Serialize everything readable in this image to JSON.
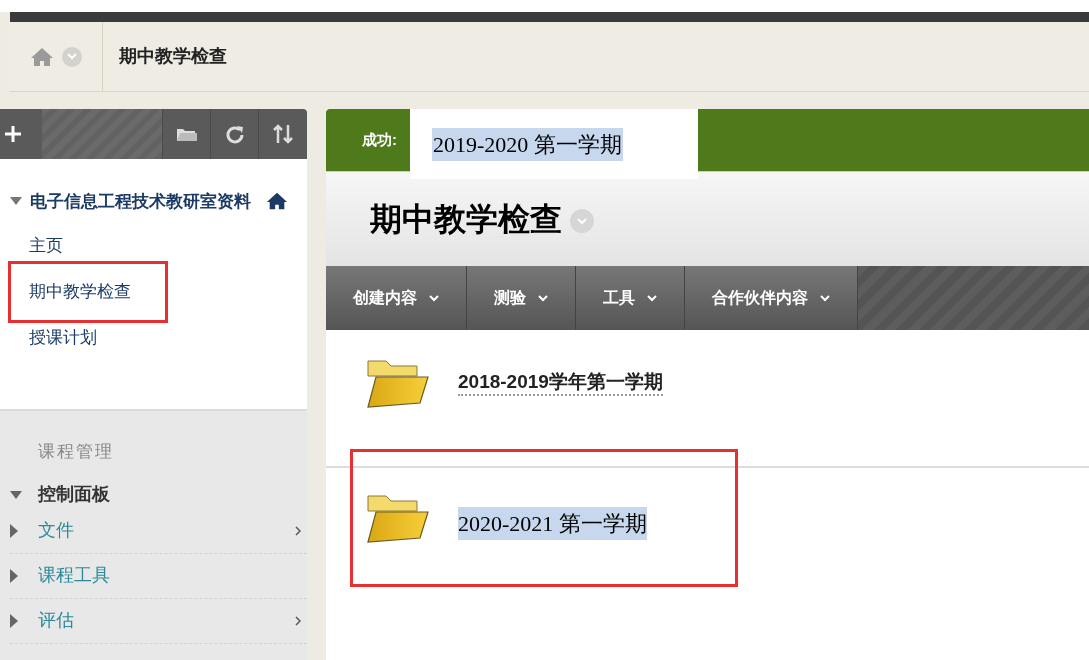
{
  "breadcrumb": {
    "title": "期中教学检查"
  },
  "sidebar": {
    "course": {
      "title": "电子信息工程技术教研室资料",
      "expanded": true
    },
    "items": [
      {
        "label": "主页",
        "annotated": false
      },
      {
        "label": "期中教学检查",
        "annotated": true
      },
      {
        "label": "授课计划",
        "annotated": false
      }
    ],
    "management": {
      "heading": "课程管理",
      "panel": {
        "label": "控制面板",
        "expanded": true
      },
      "entries": [
        {
          "label": "文件",
          "expanded": false,
          "has_submenu": true
        },
        {
          "label": "课程工具",
          "expanded": false,
          "has_submenu": false
        },
        {
          "label": "评估",
          "expanded": false,
          "has_submenu": true
        }
      ]
    }
  },
  "banner": {
    "message": "成功:",
    "overlay_text": "2019-2020 第一学期"
  },
  "content": {
    "title": "期中教学检查",
    "menu": [
      "创建内容",
      "测验",
      "工具",
      "合作伙伴内容"
    ],
    "folders": [
      {
        "label": "2018-2019学年第一学期",
        "annotated": false,
        "kind": "link"
      },
      {
        "label": "2020-2021 第一学期",
        "annotated": true,
        "kind": "pasted"
      }
    ]
  }
}
